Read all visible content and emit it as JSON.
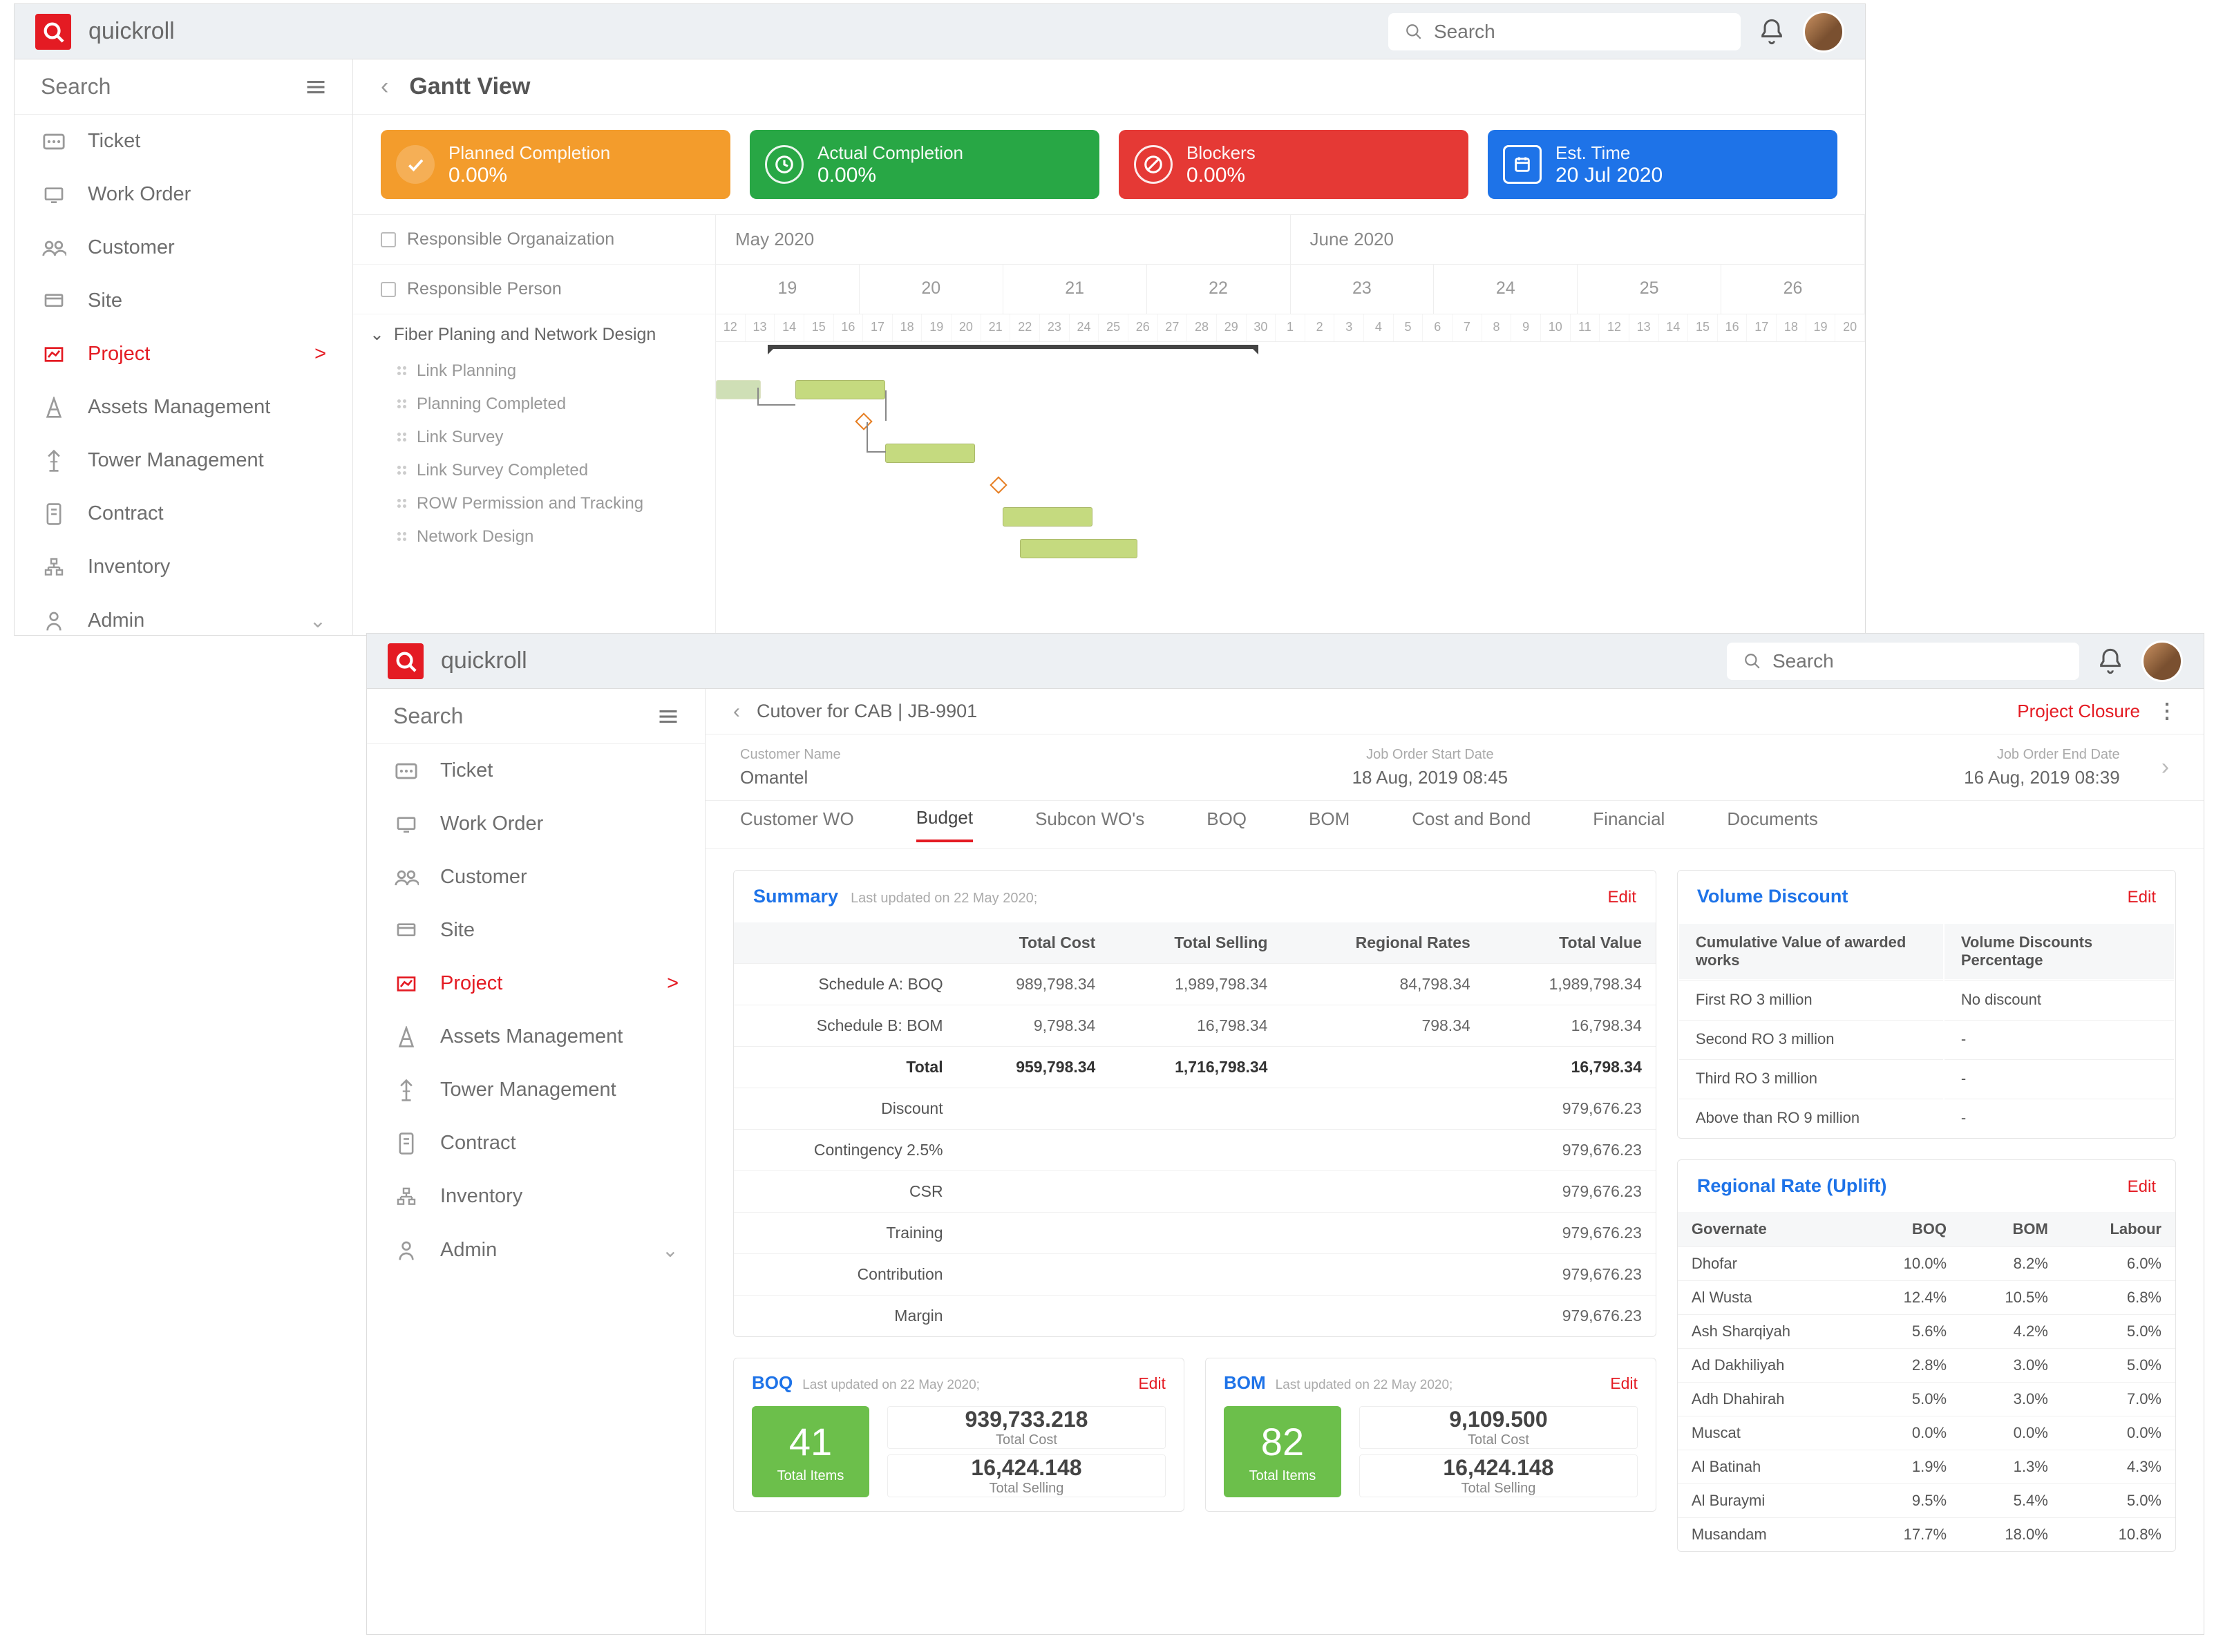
{
  "app": {
    "brand": "quickroll",
    "search_placeholder": "Search"
  },
  "sidebar": {
    "search": "Search",
    "items": [
      {
        "label": "Ticket"
      },
      {
        "label": "Work Order"
      },
      {
        "label": "Customer"
      },
      {
        "label": "Site"
      },
      {
        "label": "Project",
        "active": true,
        "chev": ">"
      },
      {
        "label": "Assets Management"
      },
      {
        "label": "Tower Management"
      },
      {
        "label": "Contract"
      },
      {
        "label": "Inventory"
      },
      {
        "label": "Admin",
        "chev": "⌄"
      }
    ]
  },
  "w1": {
    "title": "Gantt View",
    "cards": [
      {
        "title": "Planned Completion",
        "value": "0.00%"
      },
      {
        "title": "Actual Completion",
        "value": "0.00%"
      },
      {
        "title": "Blockers",
        "value": "0.00%"
      },
      {
        "title": "Est. Time",
        "value": "20 Jul 2020"
      }
    ],
    "leftHeaders": [
      "Responsible Organaization",
      "Responsible Person"
    ],
    "group": "Fiber Planing and Network Design",
    "tasks": [
      "Link Planning",
      "Planning Completed",
      "Link Survey",
      "Link Survey Completed",
      "ROW Permission and Tracking",
      "Network Design"
    ],
    "months": [
      "May 2020",
      "June 2020"
    ],
    "weeks": [
      "19",
      "20",
      "21",
      "22",
      "23",
      "24",
      "25",
      "26"
    ],
    "days": [
      "12",
      "13",
      "14",
      "15",
      "16",
      "17",
      "18",
      "19",
      "20",
      "21",
      "22",
      "23",
      "24",
      "25",
      "26",
      "27",
      "28",
      "29",
      "30",
      "1",
      "2",
      "3",
      "4",
      "5",
      "6",
      "7",
      "8",
      "9",
      "10",
      "11",
      "12",
      "13",
      "14",
      "15",
      "16",
      "17",
      "18",
      "19",
      "20"
    ]
  },
  "w2": {
    "crumb_title": "Cutover for CAB | JB-9901",
    "closure": "Project Closure",
    "info": [
      {
        "lbl": "Customer Name",
        "val": "Omantel"
      },
      {
        "lbl": "Job Order Start Date",
        "val": "18 Aug, 2019 08:45"
      },
      {
        "lbl": "Job Order End Date",
        "val": "16 Aug, 2019 08:39"
      }
    ],
    "tabs": [
      "Customer WO",
      "Budget",
      "Subcon WO's",
      "BOQ",
      "BOM",
      "Cost and Bond",
      "Financial",
      "Documents"
    ],
    "active_tab": 1,
    "summary": {
      "title": "Summary",
      "updated": "Last updated on 22 May 2020;",
      "edit": "Edit",
      "cols": [
        "",
        "Total Cost",
        "Total Selling",
        "Regional Rates",
        "Total Value"
      ],
      "rows": [
        {
          "l": "Schedule A: BOQ",
          "c": [
            "989,798.34",
            "1,989,798.34",
            "84,798.34",
            "1,989,798.34"
          ]
        },
        {
          "l": "Schedule B: BOM",
          "c": [
            "9,798.34",
            "16,798.34",
            "798.34",
            "16,798.34"
          ]
        },
        {
          "l": "Total",
          "c": [
            "959,798.34",
            "1,716,798.34",
            "",
            "16,798.34"
          ],
          "bold": true
        },
        {
          "l": "Discount",
          "c": [
            "",
            "",
            "",
            "979,676.23"
          ]
        },
        {
          "l": "Contingency 2.5%",
          "c": [
            "",
            "",
            "",
            "979,676.23"
          ]
        },
        {
          "l": "CSR",
          "c": [
            "",
            "",
            "",
            "979,676.23"
          ]
        },
        {
          "l": "Training",
          "c": [
            "",
            "",
            "",
            "979,676.23"
          ]
        },
        {
          "l": "Contribution",
          "c": [
            "",
            "",
            "",
            "979,676.23"
          ]
        },
        {
          "l": "Margin",
          "c": [
            "",
            "",
            "",
            "979,676.23"
          ]
        }
      ]
    },
    "vd": {
      "title": "Volume Discount",
      "edit": "Edit",
      "cols": [
        "Cumulative Value of awarded works",
        "Volume Discounts Percentage"
      ],
      "rows": [
        {
          "a": "First RO 3 million",
          "b": "No discount"
        },
        {
          "a": "Second RO 3 million",
          "b": "-"
        },
        {
          "a": "Third RO 3 million",
          "b": "-"
        },
        {
          "a": "Above than RO 9 million",
          "b": "-"
        }
      ]
    },
    "rr": {
      "title": "Regional Rate (Uplift)",
      "edit": "Edit",
      "cols": [
        "Governate",
        "BOQ",
        "BOM",
        "Labour"
      ],
      "rows": [
        {
          "g": "Dhofar",
          "q": "10.0%",
          "m": "8.2%",
          "l": "6.0%"
        },
        {
          "g": "Al Wusta",
          "q": "12.4%",
          "m": "10.5%",
          "l": "6.8%"
        },
        {
          "g": "Ash Sharqiyah",
          "q": "5.6%",
          "m": "4.2%",
          "l": "5.0%"
        },
        {
          "g": "Ad Dakhiliyah",
          "q": "2.8%",
          "m": "3.0%",
          "l": "5.0%"
        },
        {
          "g": "Adh Dhahirah",
          "q": "5.0%",
          "m": "3.0%",
          "l": "7.0%"
        },
        {
          "g": "Muscat",
          "q": "0.0%",
          "m": "0.0%",
          "l": "0.0%"
        },
        {
          "g": "Al Batinah",
          "q": "1.9%",
          "m": "1.3%",
          "l": "4.3%"
        },
        {
          "g": "Al Buraymi",
          "q": "9.5%",
          "m": "5.4%",
          "l": "5.0%"
        },
        {
          "g": "Musandam",
          "q": "17.7%",
          "m": "18.0%",
          "l": "10.8%"
        }
      ]
    },
    "boq": {
      "name": "BOQ",
      "updated": "Last updated on 22 May 2020;",
      "edit": "Edit",
      "count": "41",
      "count_lbl": "Total Items",
      "stat1_v": "939,733.218",
      "stat1_l": "Total Cost",
      "stat2_v": "16,424.148",
      "stat2_l": "Total Selling"
    },
    "bom": {
      "name": "BOM",
      "updated": "Last updated on 22 May 2020;",
      "edit": "Edit",
      "count": "82",
      "count_lbl": "Total Items",
      "stat1_v": "9,109.500",
      "stat1_l": "Total Cost",
      "stat2_v": "16,424.148",
      "stat2_l": "Total Selling"
    }
  }
}
